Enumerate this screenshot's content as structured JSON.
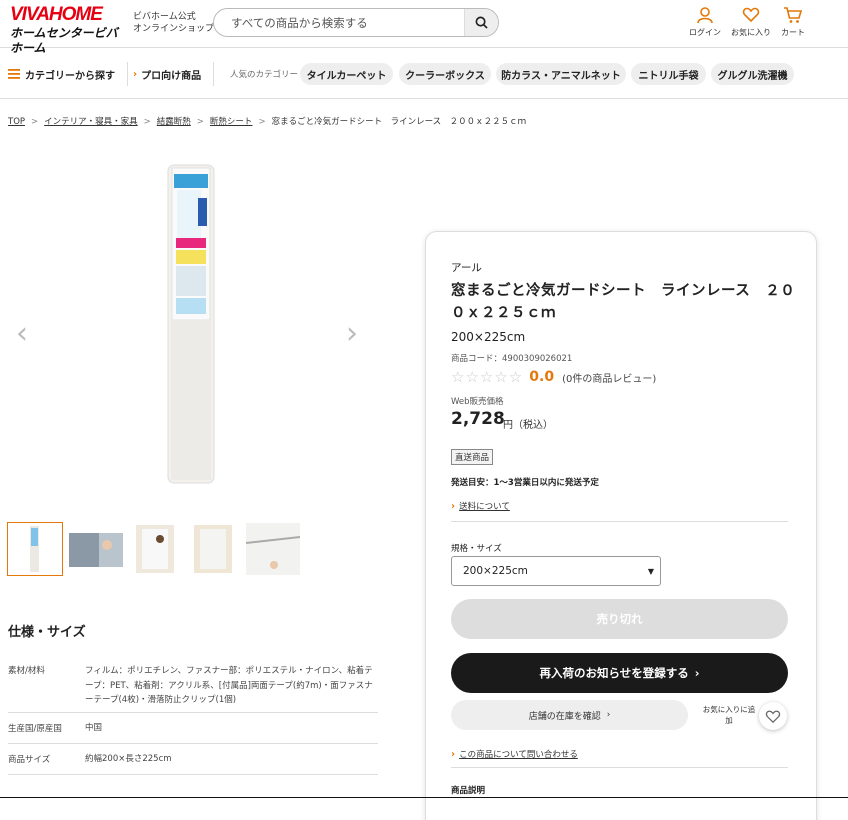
{
  "header": {
    "logo_top": "VIVAHOME",
    "logo_bottom": "ホームセンタービバホーム",
    "shop_label_1": "ビバホーム公式",
    "shop_label_2": "オンラインショップ",
    "search_placeholder": "すべての商品から検索する",
    "login": "ログイン",
    "favorites": "お気に入り",
    "cart": "カート"
  },
  "nav": {
    "categories": "カテゴリーから探す",
    "pro": "プロ向け商品",
    "popular_label": "人気のカテゴリー",
    "chips": [
      "タイルカーペット",
      "クーラーボックス",
      "防カラス・アニマルネット",
      "ニトリル手袋",
      "グルグル洗濯機"
    ]
  },
  "breadcrumb": [
    "TOP",
    "インテリア・寝具・家具",
    "結露断熱",
    "断熱シート",
    "窓まるごと冷気ガードシート　ラインレース　２００ｘ２２５ｃｍ"
  ],
  "product": {
    "brand": "アール",
    "name": "窓まるごと冷気ガードシート　ラインレース　２００ｘ２２５ｃｍ",
    "size": "200×225cm",
    "code": "商品コード：4900309026021",
    "rating": "0.0",
    "reviews": "(0件の商品レビュー)",
    "web_price_label": "Web販売価格",
    "price": "2,728",
    "price_unit": "円（税込）",
    "badge": "直送商品",
    "shipping": "発送目安：1〜3営業日以内に発送予定",
    "shipping_link": "送料について",
    "variant_label": "規格・サイズ",
    "variant_value": "200×225cm",
    "soldout_button": "売り切れ",
    "notify_button": "再入荷のお知らせを登録する",
    "store_button": "店舗の在庫を確認",
    "fav_label": "お気に入りに追加",
    "inquiry_link": "この商品について問い合わせる",
    "desc_title": "商品説明"
  },
  "spec": {
    "title": "仕様・サイズ",
    "rows": [
      {
        "k": "素材/材料",
        "v": "フィルム：ポリエチレン、ファスナー部：ポリエステル・ナイロン、粘着テープ：PET、粘着剤：アクリル系、[付属品]両面テープ(約7m)・面ファスナーテープ(4枚)・滑落防止クリップ(1個)"
      },
      {
        "k": "生産国/原産国",
        "v": "中国"
      },
      {
        "k": "商品サイズ",
        "v": "約幅200×長さ225cm"
      }
    ]
  },
  "colors": {
    "accent": "#e4780a",
    "brand_red": "#e60012",
    "dark_button": "#1a1a1a"
  }
}
